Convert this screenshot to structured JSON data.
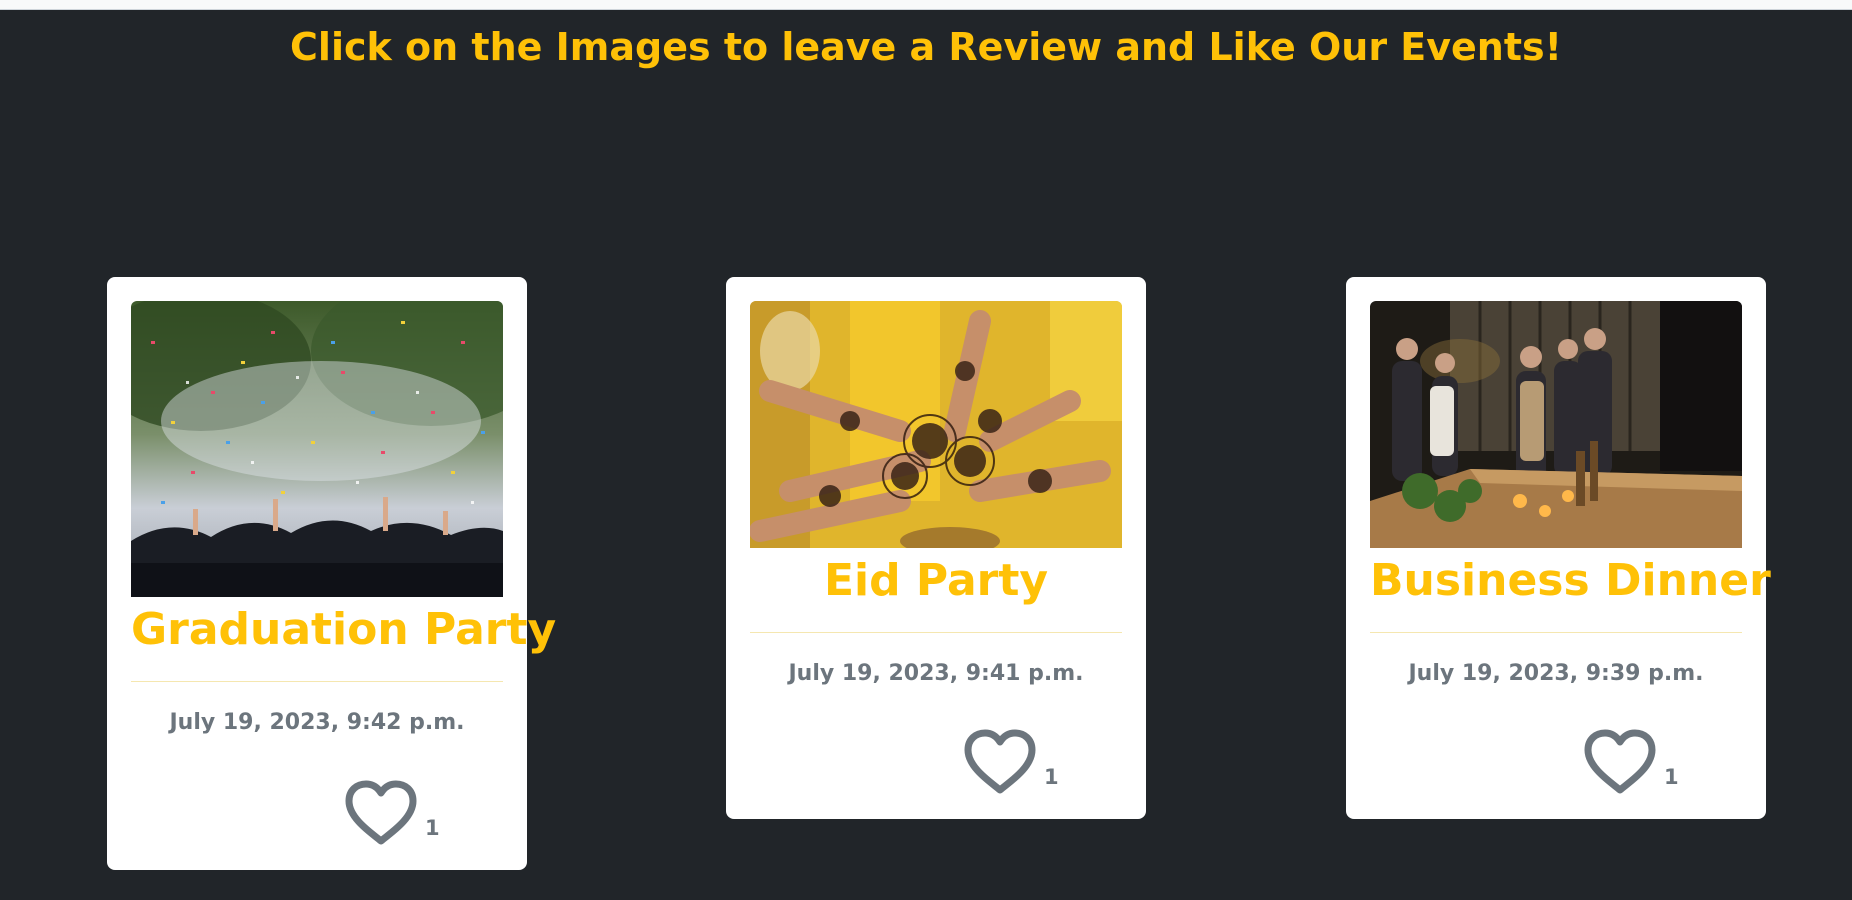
{
  "header": {
    "title": "Click on the Images to leave a Review and Like Our Events!"
  },
  "events": [
    {
      "title": "Graduation Party",
      "date": "July 19, 2023, 9:42 p.m.",
      "likes": "1",
      "image": "graduation-confetti-photo"
    },
    {
      "title": "Eid Party",
      "date": "July 19, 2023, 9:41 p.m.",
      "likes": "1",
      "image": "henna-hands-photo"
    },
    {
      "title": "Business Dinner",
      "date": "July 19, 2023, 9:39 p.m.",
      "likes": "1",
      "image": "business-dinner-photo"
    }
  ],
  "colors": {
    "background": "#212529",
    "accent": "#ffc107",
    "muted": "#6c757d",
    "card": "#ffffff"
  }
}
